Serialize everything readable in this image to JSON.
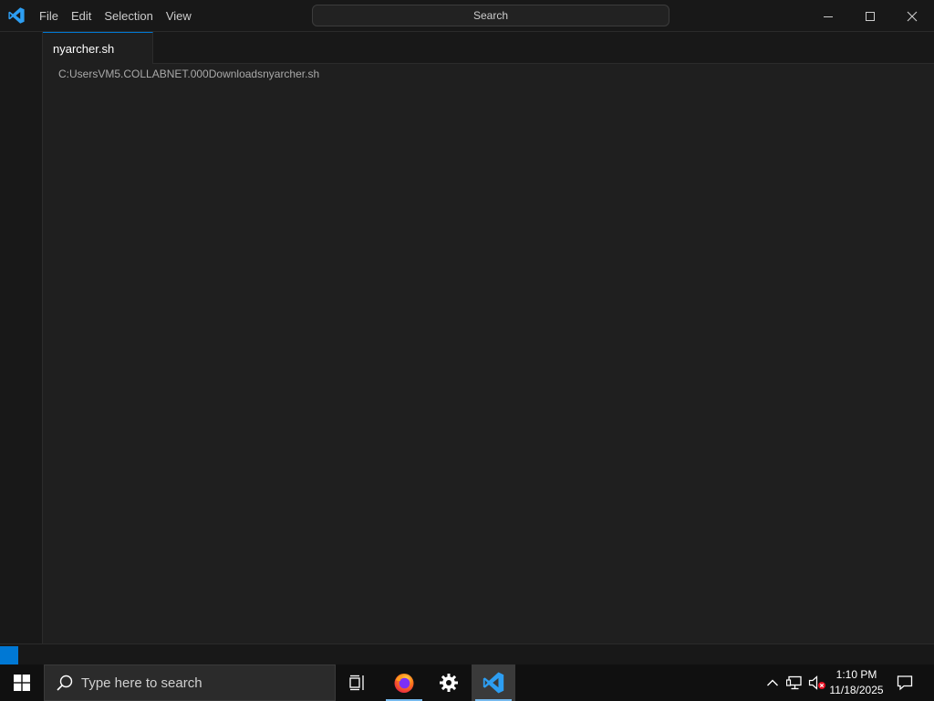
{
  "titlebar": {
    "menu": [
      "File",
      "Edit",
      "Selection",
      "View"
    ],
    "command_center": "Search"
  },
  "tabs": [
    {
      "label": "nyarcher.sh"
    }
  ],
  "editor": {
    "breadcrumb": "C:UsersVM5.COLLABNET.000Downloadsnyarcher.sh"
  },
  "taskbar": {
    "search_placeholder": "Type here to search",
    "time": "1:10 PM",
    "date": "11/18/2025"
  },
  "colors": {
    "accent": "#0078d4",
    "editor_bg": "#1f1f1f",
    "chrome_bg": "#181818",
    "taskbar_bg": "#101010"
  },
  "icons": {
    "app": "vscode-icon",
    "window_controls": [
      "minimize-icon",
      "maximize-icon",
      "close-icon"
    ],
    "taskbar": [
      "windows-start-icon",
      "search-icon",
      "task-view-icon",
      "firefox-icon",
      "settings-gear-icon",
      "vscode-icon"
    ],
    "tray": [
      "chevron-up-icon",
      "network-icon",
      "volume-muted-icon",
      "notification-icon"
    ]
  }
}
